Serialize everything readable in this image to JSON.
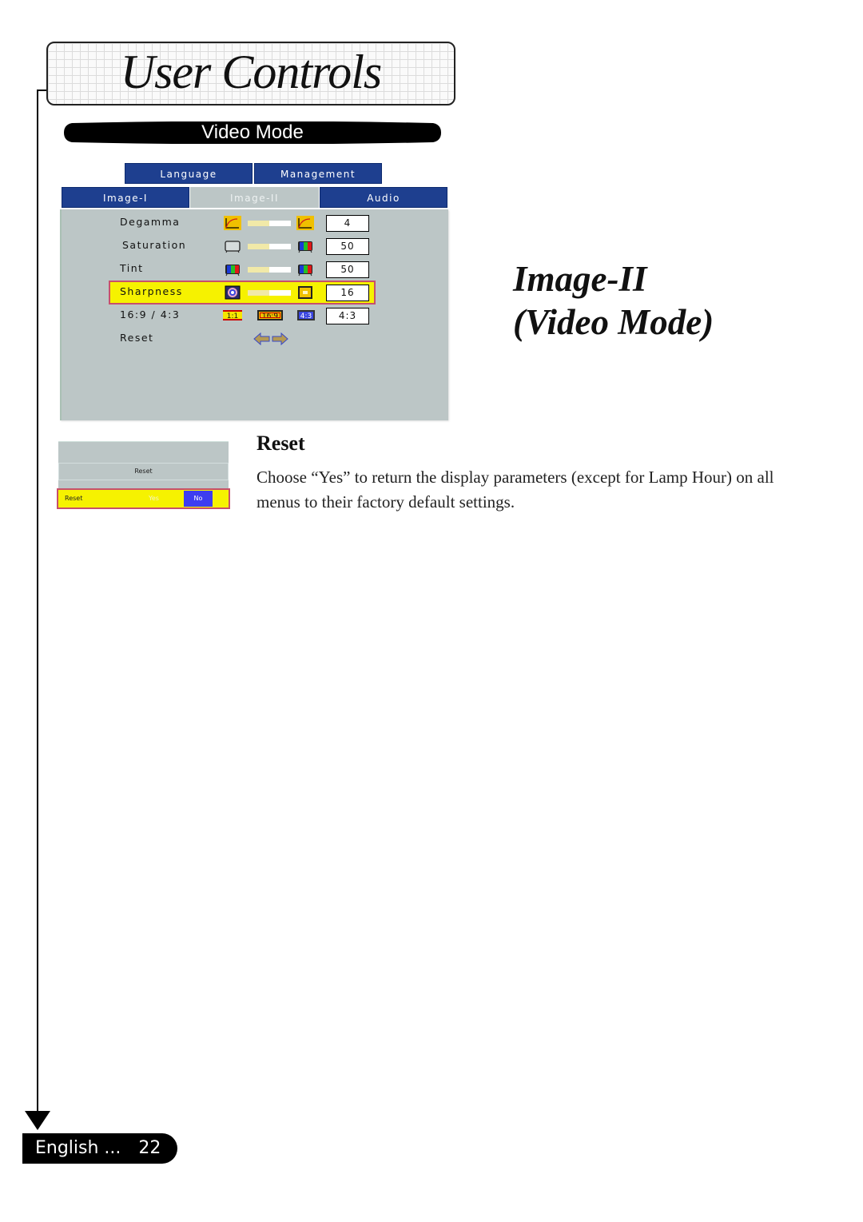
{
  "header": {
    "title": "User Controls",
    "section": "Video Mode"
  },
  "osd": {
    "tabs_top": [
      {
        "label": "Language",
        "active": false
      },
      {
        "label": "Management",
        "active": false
      }
    ],
    "tabs_bottom": [
      {
        "label": "Image-I",
        "active": false
      },
      {
        "label": "Image-II",
        "active": true
      },
      {
        "label": "Audio",
        "active": false
      }
    ],
    "rows": [
      {
        "label": "Degamma",
        "value": "4",
        "slider_fraction": 0.5,
        "icon_left": "degamma-curve-icon",
        "icon_right": "degamma-curve-icon",
        "selected": false
      },
      {
        "label": "Saturation",
        "value": "50",
        "slider_fraction": 0.5,
        "icon_left": "gray-tv-icon",
        "icon_right": "color-tv-icon",
        "selected": false
      },
      {
        "label": "Tint",
        "value": "50",
        "slider_fraction": 0.5,
        "icon_left": "color-tv-icon",
        "icon_right": "color-tv-icon",
        "selected": false
      },
      {
        "label": "Sharpness",
        "value": "16",
        "slider_fraction": 0.5,
        "icon_left": "sharpness-soft-icon",
        "icon_right": "sharpness-sharp-icon",
        "selected": true
      }
    ],
    "aspect": {
      "label": "16:9 / 4:3",
      "options": [
        "1:1",
        "16:9",
        "4:3"
      ],
      "value": "4:3"
    },
    "reset": {
      "label": "Reset",
      "icons": [
        "arrow-left-icon",
        "arrow-right-icon"
      ]
    }
  },
  "page_heading": {
    "line1": "Image-II",
    "line2": "(Video Mode)"
  },
  "reset_dialog": {
    "title": "Reset",
    "row_label": "Reset",
    "yes": "Yes",
    "no": "No"
  },
  "reset_section": {
    "heading": "Reset",
    "body": "Choose “Yes” to return the display parameters (except for Lamp Hour) on all menus to their factory default settings."
  },
  "footer": {
    "language": "English ...",
    "page": "22"
  },
  "colors": {
    "tab_blue": "#1e3f8f",
    "osd_gray": "#bcc6c6",
    "highlight_yellow": "#f6f200",
    "highlight_border": "#c7506b",
    "no_button_blue": "#3d3df0"
  }
}
